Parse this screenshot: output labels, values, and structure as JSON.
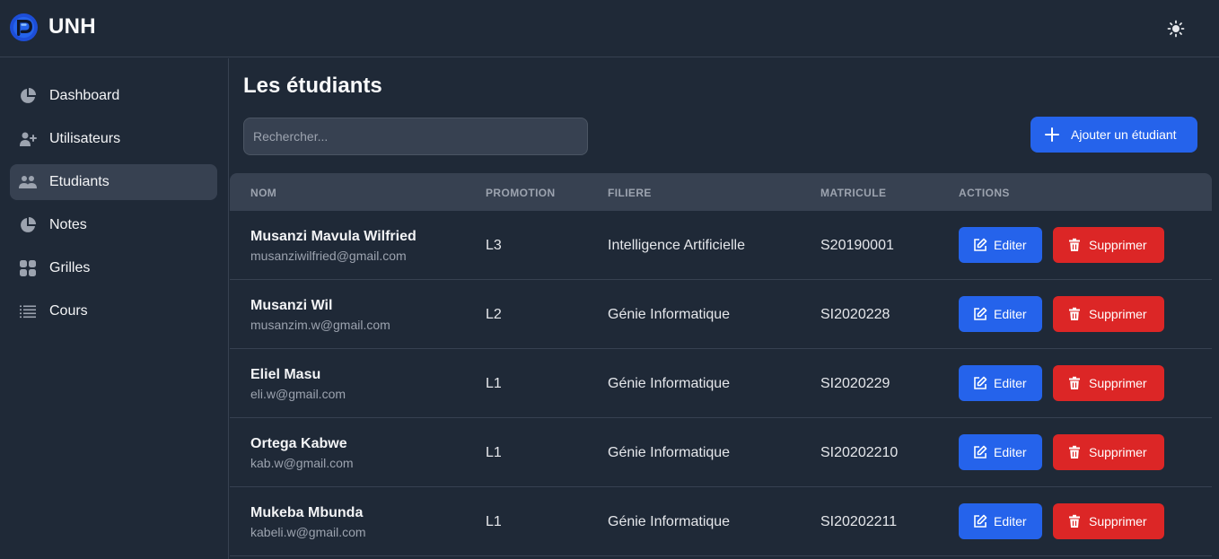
{
  "app": {
    "brand": "UNH"
  },
  "colors": {
    "accent": "#2563eb",
    "danger": "#dc2626",
    "background": "#1f2937",
    "panel": "#374151"
  },
  "topbar": {
    "theme_icon": "sun-icon"
  },
  "sidebar": {
    "items": [
      {
        "label": "Dashboard",
        "icon": "pie-chart-icon",
        "active": false
      },
      {
        "label": "Utilisateurs",
        "icon": "user-plus-icon",
        "active": false
      },
      {
        "label": "Etudiants",
        "icon": "users-icon",
        "active": true
      },
      {
        "label": "Notes",
        "icon": "pie-chart-icon",
        "active": false
      },
      {
        "label": "Grilles",
        "icon": "grid-icon",
        "active": false
      },
      {
        "label": "Cours",
        "icon": "list-icon",
        "active": false
      }
    ]
  },
  "main": {
    "title": "Les étudiants",
    "search": {
      "placeholder": "Rechercher...",
      "value": ""
    },
    "add_button": {
      "label": "Ajouter un étudiant",
      "icon": "plus-icon"
    }
  },
  "table": {
    "columns": [
      "NOM",
      "PROMOTION",
      "FILIERE",
      "MATRICULE",
      "ACTIONS"
    ],
    "rows": [
      {
        "name": "Musanzi Mavula Wilfried",
        "email": "musanziwilfried@gmail.com",
        "promotion": "L3",
        "filiere": "Intelligence Artificielle",
        "matricule": "S20190001"
      },
      {
        "name": "Musanzi Wil",
        "email": "musanzim.w@gmail.com",
        "promotion": "L2",
        "filiere": "Génie Informatique",
        "matricule": "SI2020228"
      },
      {
        "name": "Eliel Masu",
        "email": "eli.w@gmail.com",
        "promotion": "L1",
        "filiere": "Génie Informatique",
        "matricule": "SI2020229"
      },
      {
        "name": "Ortega Kabwe",
        "email": "kab.w@gmail.com",
        "promotion": "L1",
        "filiere": "Génie Informatique",
        "matricule": "SI20202210"
      },
      {
        "name": "Mukeba Mbunda",
        "email": "kabeli.w@gmail.com",
        "promotion": "L1",
        "filiere": "Génie Informatique",
        "matricule": "SI20202211"
      }
    ],
    "actions": {
      "edit_label": "Editer",
      "delete_label": "Supprimer",
      "edit_icon": "edit-icon",
      "delete_icon": "trash-icon"
    }
  }
}
